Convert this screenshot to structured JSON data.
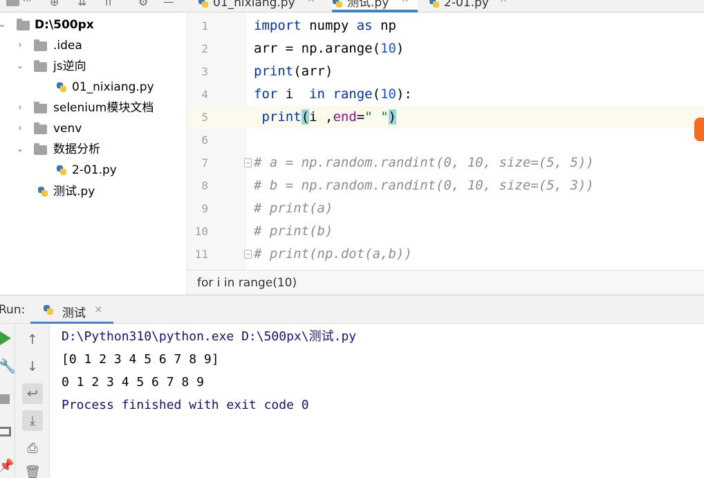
{
  "toolbar": {
    "dots": "...",
    "icons": [
      "project-folder-icon",
      "add-circle-icon",
      "collapse-all-icon",
      "scroll-from-source-icon",
      "gear-icon",
      "hide-icon"
    ]
  },
  "tabs": [
    {
      "label": "01_nixiang.py",
      "active": false
    },
    {
      "label": "测试.py",
      "active": true
    },
    {
      "label": "2-01.py",
      "active": false
    }
  ],
  "tab_close_glyph": "×",
  "project_tree": [
    {
      "label": "D:\\500px",
      "type": "folder",
      "expanded": true,
      "bold": true
    },
    {
      "label": ".idea",
      "type": "folder",
      "expanded": false
    },
    {
      "label": "js逆向",
      "type": "folder",
      "expanded": true
    },
    {
      "label": "01_nixiang.py",
      "type": "python-file"
    },
    {
      "label": "selenium模块文档",
      "type": "folder",
      "expanded": false
    },
    {
      "label": "venv",
      "type": "folder",
      "expanded": false
    },
    {
      "label": "数据分析",
      "type": "folder",
      "expanded": true
    },
    {
      "label": "2-01.py",
      "type": "python-file"
    },
    {
      "label": "测试.py",
      "type": "python-file"
    }
  ],
  "editor": {
    "line_numbers": [
      "1",
      "2",
      "3",
      "4",
      "5",
      "6",
      "7",
      "8",
      "9",
      "10",
      "11"
    ],
    "code": {
      "l1": {
        "kw_import": "import",
        "mod": " numpy ",
        "kw_as": "as",
        "alias": " np"
      },
      "l2": {
        "pre": "arr = np.arange(",
        "num": "10",
        "post": ")"
      },
      "l3": {
        "fn": "print",
        "post": "(arr)"
      },
      "l4": {
        "kw_for": "for",
        "var": " i  ",
        "kw_in": "in",
        "fn": " range",
        "p1": "(",
        "num": "10",
        "p2": "):"
      },
      "l5": {
        "indent": " ",
        "fn": "print",
        "open": "(",
        "arg": "i ,",
        "param": "end",
        "eq": "=",
        "str": "\" \"",
        "close": ")"
      },
      "l7": "# a = np.random.randint(0, 10, size=(5, 5))",
      "l8": "# b = np.random.randint(0, 10, size=(5, 3))",
      "l9": "# print(a)",
      "l10": "# print(b)",
      "l11": "# print(np.dot(a,b))"
    },
    "current_line": 5
  },
  "breadcrumb": "for i in range(10)",
  "run_panel": {
    "label": "Run:",
    "tab_label": "测试",
    "console_lines": [
      {
        "text": "D:\\Python310\\python.exe D:\\500px\\测试.py",
        "kind": "system"
      },
      {
        "text": "[0 1 2 3 4 5 6 7 8 9]",
        "kind": "output"
      },
      {
        "text": "0 1 2 3 4 5 6 7 8 9 ",
        "kind": "output"
      },
      {
        "text": "Process finished with exit code 0",
        "kind": "system"
      }
    ],
    "side_icons": [
      "up-arrow-icon",
      "down-arrow-icon",
      "soft-wrap-icon",
      "scroll-to-end-icon",
      "print-icon",
      "trash-icon"
    ]
  },
  "colors": {
    "keyword": "#0033b3",
    "number": "#1750eb",
    "string": "#067d17",
    "param": "#871094",
    "comment": "#8c8c8c",
    "console_system": "#14127d",
    "accent": "#4083c9"
  }
}
